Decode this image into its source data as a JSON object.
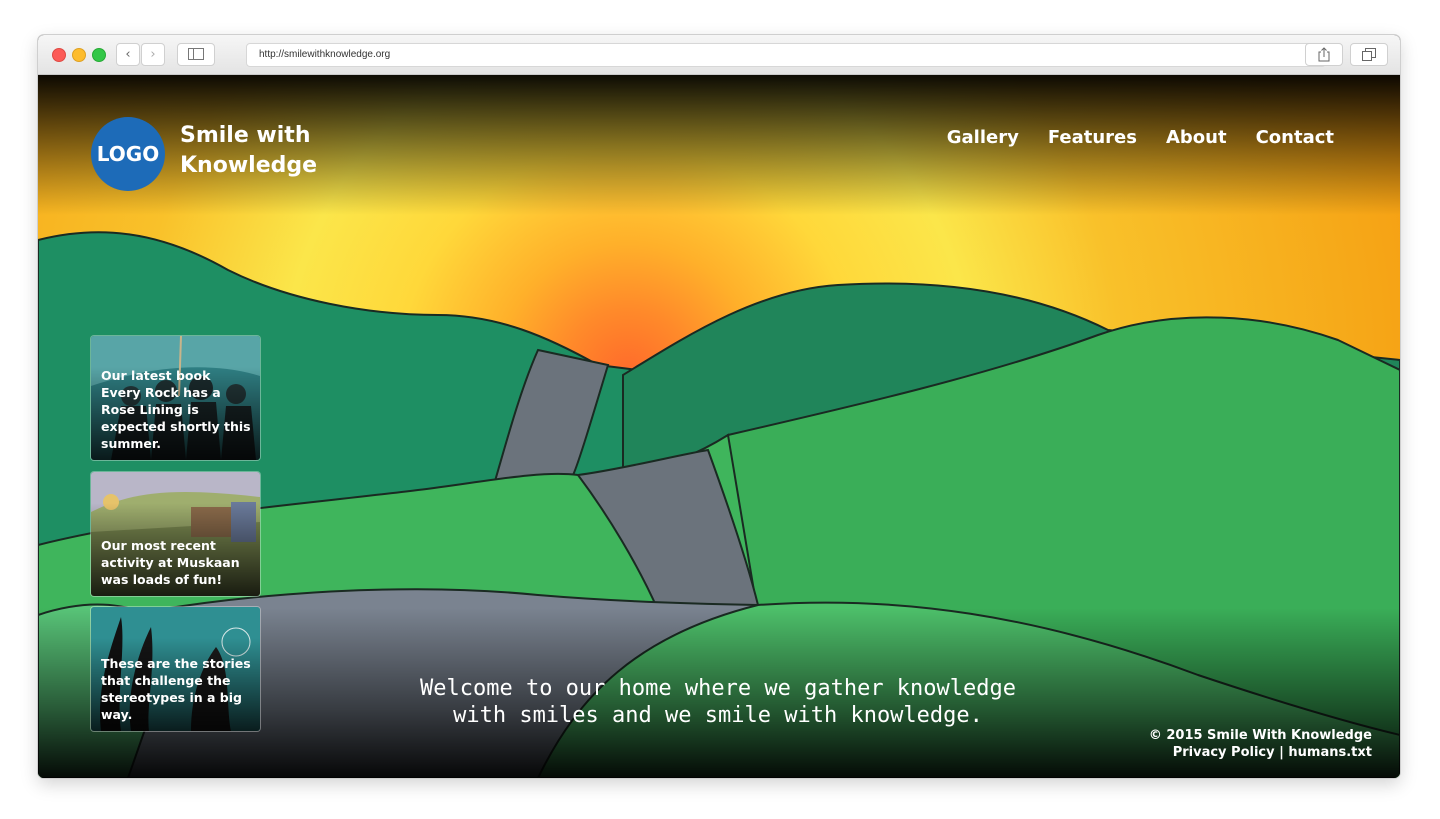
{
  "browser": {
    "url": "http://smilewithknowledge.org",
    "back_label": "‹",
    "forward_label": "›"
  },
  "header": {
    "logo_text": "LOGO",
    "brand_line1": "Smile with",
    "brand_line2": "Knowledge",
    "nav": [
      "Gallery",
      "Features",
      "About",
      "Contact"
    ]
  },
  "cards": [
    {
      "text": "Our latest book Every Rock has a Rose Lining is expected shortly this summer."
    },
    {
      "text": "Our most recent activity at Muskaan was loads of fun!"
    },
    {
      "text": "These are the stories that challenge the stereotypes in a big way."
    }
  ],
  "welcome": {
    "line1": "Welcome to our home where we gather knowledge",
    "line2": "with smiles and we smile with knowledge."
  },
  "footer": {
    "copyright": "© 2015 Smile With Knowledge",
    "privacy": "Privacy Policy",
    "separator": " | ",
    "humans": "humans.txt"
  },
  "colors": {
    "logo": "#1d6bb8",
    "sky_top": "#f6b417",
    "sun": "#ff5a2a",
    "hill_dark": "#1f8d5c",
    "hill_light": "#43b25a",
    "road": "#6b737c"
  }
}
